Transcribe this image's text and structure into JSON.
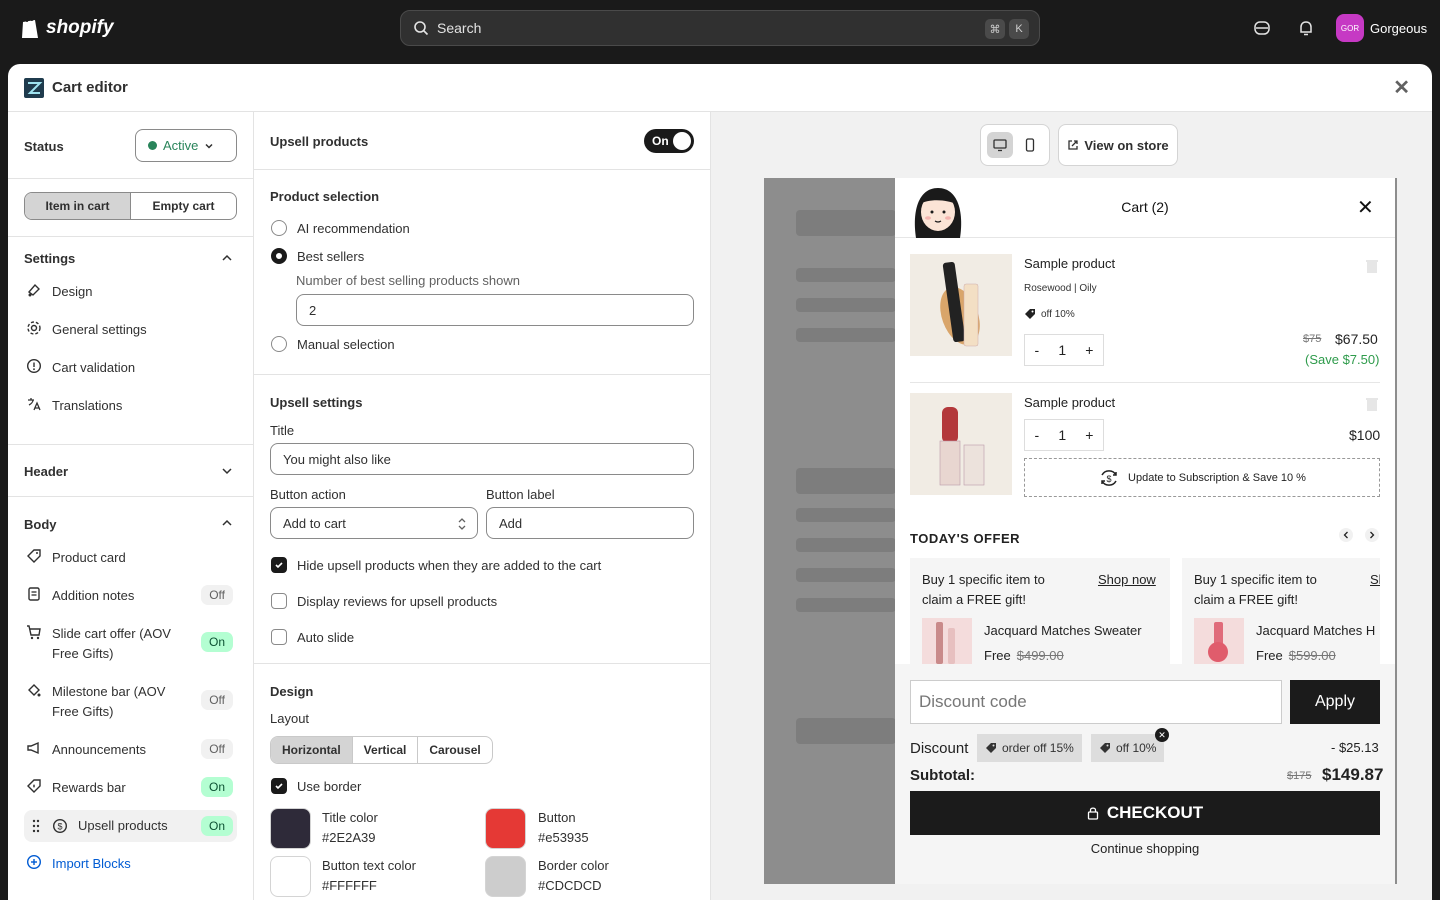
{
  "topbar": {
    "brand": "shopify",
    "search_placeholder": "Search",
    "kbd_cmd": "⌘",
    "kbd_k": "K",
    "store_initials": "GOR",
    "store_name": "Gorgeous"
  },
  "modal": {
    "title": "Cart editor",
    "close": "✕"
  },
  "left": {
    "status_label": "Status",
    "status_value": "Active",
    "tabs": [
      "Item in cart",
      "Empty cart"
    ],
    "settings_title": "Settings",
    "settings_items": [
      "Design",
      "General settings",
      "Cart validation",
      "Translations"
    ],
    "header_title": "Header",
    "body_title": "Body",
    "body_items": [
      {
        "label": "Product card",
        "badge": ""
      },
      {
        "label": "Addition notes",
        "badge": "Off"
      },
      {
        "label": "Slide cart offer (AOV Free Gifts)",
        "badge": "On"
      },
      {
        "label": "Milestone bar (AOV Free Gifts)",
        "badge": "Off"
      },
      {
        "label": "Announcements",
        "badge": "Off"
      },
      {
        "label": "Rewards bar",
        "badge": "On"
      },
      {
        "label": "Upsell products",
        "badge": "On"
      }
    ],
    "import_blocks": "Import Blocks"
  },
  "mid": {
    "upsell_title": "Upsell products",
    "toggle_label": "On",
    "product_selection_title": "Product selection",
    "radios": [
      "AI recommendation",
      "Best sellers",
      "Manual selection"
    ],
    "num_label": "Number of best selling products shown",
    "num_value": "2",
    "upsell_settings_title": "Upsell settings",
    "title_label": "Title",
    "title_value": "You might also like",
    "button_action_label": "Button action",
    "button_action_value": "Add to cart",
    "button_label_label": "Button label",
    "button_label_value": "Add",
    "checkboxes": [
      "Hide upsell products when they are added to the cart",
      "Display reviews for upsell products",
      "Auto slide"
    ],
    "design_title": "Design",
    "layout_label": "Layout",
    "layout_options": [
      "Horizontal",
      "Vertical",
      "Carousel"
    ],
    "use_border": "Use border",
    "colors": [
      {
        "name": "Title color",
        "hex": "#2E2A39",
        "swatch": "#2e2a39"
      },
      {
        "name": "Button",
        "hex": "#e53935",
        "swatch": "#e53935"
      },
      {
        "name": "Button text color",
        "hex": "#FFFFFF",
        "swatch": "#ffffff"
      },
      {
        "name": "Border color",
        "hex": "#CDCDCD",
        "swatch": "#cdcdcd"
      }
    ]
  },
  "preview": {
    "view_on_store": "View on store",
    "cart_title": "Cart (2)",
    "items": [
      {
        "name": "Sample product",
        "variant": "Rosewood | Oily",
        "discount": "off 10%",
        "qty": "1",
        "old_price": "$75",
        "price": "$67.50",
        "save": "(Save $7.50)"
      },
      {
        "name": "Sample product",
        "qty": "1",
        "price": "$100"
      }
    ],
    "subscription": "Update to Subscription & Save 10 %",
    "offer_title": "TODAY'S OFFER",
    "offers": [
      {
        "title": "Buy 1 specific item to claim a FREE gift!",
        "link": "Shop now",
        "product": "Jacquard Matches Sweater",
        "free": "Free",
        "old": "$499.00"
      },
      {
        "title": "Buy 1 specific item to claim a FREE gift!",
        "link": "Sl",
        "product": "Jacquard Matches H",
        "free": "Free",
        "old": "$599.00"
      }
    ],
    "discount_placeholder": "Discount code",
    "apply": "Apply",
    "discount_label": "Discount",
    "tags": [
      "order off 15%",
      "off 10%"
    ],
    "discount_amount": "- $25.13",
    "subtotal_label": "Subtotal:",
    "subtotal_old": "$175",
    "subtotal": "$149.87",
    "checkout": "CHECKOUT",
    "continue": "Continue shopping"
  }
}
